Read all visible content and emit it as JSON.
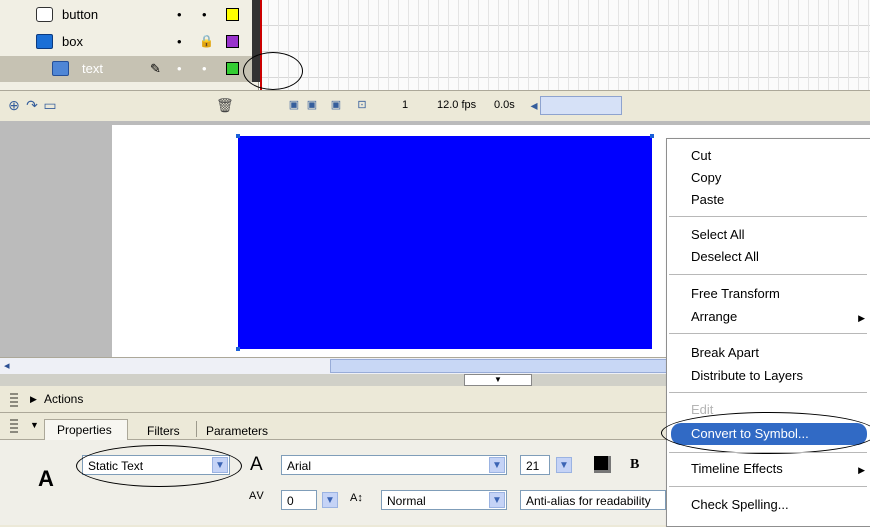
{
  "timeline": {
    "layers": [
      {
        "name": "button",
        "locked": false,
        "color": "#ffff00"
      },
      {
        "name": "box",
        "locked": true,
        "color": "#9933cc"
      },
      {
        "name": "text",
        "locked": false,
        "color": "#33cc33",
        "selected": true
      }
    ],
    "frame_number": "1",
    "fps": "12.0 fps",
    "elapsed": "0.0s"
  },
  "colors": {
    "stage_box": "#0000ff",
    "menu_highlight": "#316ac5"
  },
  "panels": {
    "actions_label": "Actions",
    "tabs": [
      "Properties",
      "Filters",
      "Parameters"
    ],
    "text_type": "Static Text",
    "font": "Arial",
    "font_size": "21",
    "bold_label": "B",
    "letter_spacing": "0",
    "char_position": "Normal",
    "anti_alias": "Anti-alias for readability"
  },
  "context_menu": {
    "group1": [
      "Cut",
      "Copy",
      "Paste"
    ],
    "group2": [
      "Select All",
      "Deselect All"
    ],
    "group3": [
      "Free Transform",
      "Arrange"
    ],
    "group4": [
      "Break Apart",
      "Distribute to Layers"
    ],
    "group5": [
      "Edit",
      "Convert to Symbol..."
    ],
    "group6": [
      "Timeline Effects"
    ],
    "group7": [
      "Check Spelling..."
    ]
  }
}
